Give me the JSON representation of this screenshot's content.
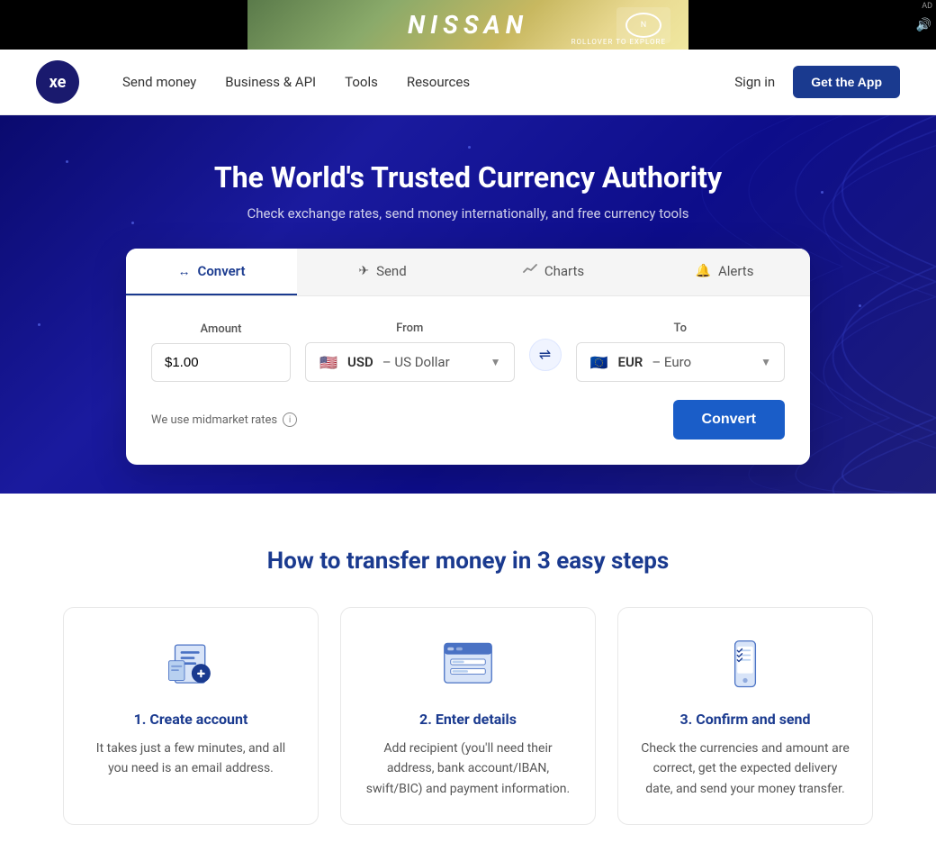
{
  "ad": {
    "brand": "NISSAN",
    "cta": "ROLLOVER TO EXPLORE",
    "ad_label": "AD"
  },
  "navbar": {
    "logo_text": "xe",
    "links": [
      {
        "label": "Send money",
        "id": "send-money"
      },
      {
        "label": "Business & API",
        "id": "business-api"
      },
      {
        "label": "Tools",
        "id": "tools"
      },
      {
        "label": "Resources",
        "id": "resources"
      }
    ],
    "sign_in": "Sign in",
    "get_app": "Get the App"
  },
  "hero": {
    "title": "The World's Trusted Currency Authority",
    "subtitle": "Check exchange rates, send money internationally, and free currency tools"
  },
  "converter": {
    "tabs": [
      {
        "label": "Convert",
        "id": "convert",
        "icon": "↔",
        "active": true
      },
      {
        "label": "Send",
        "id": "send",
        "icon": "✈",
        "active": false
      },
      {
        "label": "Charts",
        "id": "charts",
        "icon": "📈",
        "active": false
      },
      {
        "label": "Alerts",
        "id": "alerts",
        "icon": "🔔",
        "active": false
      }
    ],
    "fields": {
      "amount_label": "Amount",
      "amount_value": "$1.00",
      "from_label": "From",
      "from_currency_code": "USD",
      "from_currency_name": "US Dollar",
      "from_flag": "🇺🇸",
      "to_label": "To",
      "to_currency_code": "EUR",
      "to_currency_name": "Euro",
      "to_flag": "🇪🇺"
    },
    "midmarket_note": "We use midmarket rates",
    "convert_btn": "Convert"
  },
  "steps": {
    "title": "How to transfer money in 3 easy steps",
    "items": [
      {
        "number": "1",
        "title": "1. Create account",
        "description": "It takes just a few minutes, and all you need is an email address."
      },
      {
        "number": "2",
        "title": "2. Enter details",
        "description": "Add recipient (you'll need their address, bank account/IBAN, swift/BIC) and payment information."
      },
      {
        "number": "3",
        "title": "3. Confirm and send",
        "description": "Check the currencies and amount are correct, get the expected delivery date, and send your money transfer."
      }
    ]
  }
}
